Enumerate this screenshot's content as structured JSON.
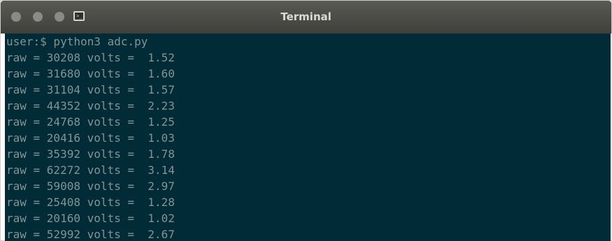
{
  "window": {
    "title": "Terminal",
    "colors": {
      "titlebar": "#4a4a46",
      "terminal_bg": "#012b36",
      "terminal_fg": "#839496",
      "title_text": "#dcdcd6"
    },
    "icon": "terminal-icon"
  },
  "terminal": {
    "prompt": "user:$ python3 adc.py",
    "lines": [
      "raw = 30208 volts =  1.52",
      "raw = 31680 volts =  1.60",
      "raw = 31104 volts =  1.57",
      "raw = 44352 volts =  2.23",
      "raw = 24768 volts =  1.25",
      "raw = 20416 volts =  1.03",
      "raw = 35392 volts =  1.78",
      "raw = 62272 volts =  3.14",
      "raw = 59008 volts =  2.97",
      "raw = 25408 volts =  1.28",
      "raw = 20160 volts =  1.02",
      "raw = 52992 volts =  2.67"
    ]
  }
}
